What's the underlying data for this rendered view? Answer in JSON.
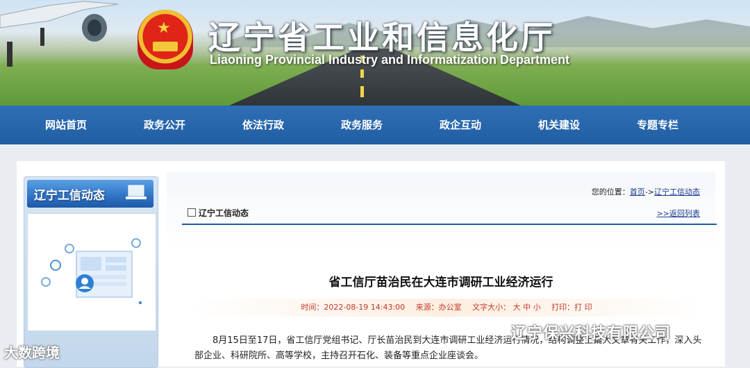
{
  "header": {
    "title_cn": "辽宁省工业和信息化厅",
    "title_en": "Liaoning Provincial Industry and Informatization Department"
  },
  "nav": {
    "items": [
      {
        "label": "网站首页"
      },
      {
        "label": "政务公开"
      },
      {
        "label": "依法行政"
      },
      {
        "label": "政务服务"
      },
      {
        "label": "政企互动"
      },
      {
        "label": "机关建设"
      },
      {
        "label": "专题专栏"
      }
    ]
  },
  "sidebar": {
    "heading": "辽宁工信动态"
  },
  "main": {
    "breadcrumb_prefix": "您的位置：",
    "breadcrumb_home": "首页",
    "breadcrumb_sep": "->",
    "breadcrumb_current": "辽宁工信动态",
    "section_title": "辽宁工信动态",
    "back_link": ">>返回列表",
    "article_title": "省工信厅苗治民在大连市调研工业经济运行",
    "meta": {
      "time": "时间：2022-08-19 14:43:00",
      "source": "来源：办公室",
      "font_size": "文字大小：  大  中  小",
      "print": "打印：打 印"
    },
    "body": "8月15日至17日，省工信厅党组书记、厅长苗治民到大连市调研工业经济运行情况，结构调整上篇大文章有关工作，深入头部企业、科研院所、高等学校，主持召开石化、装备等重点企业座谈会。"
  },
  "watermarks": {
    "left": "大数跨境",
    "right": "辽宁保兴科技有限公司"
  },
  "colors": {
    "nav_blue": "#2563a8",
    "link_blue": "#1a3a8a",
    "meta_red": "#c0392b"
  }
}
